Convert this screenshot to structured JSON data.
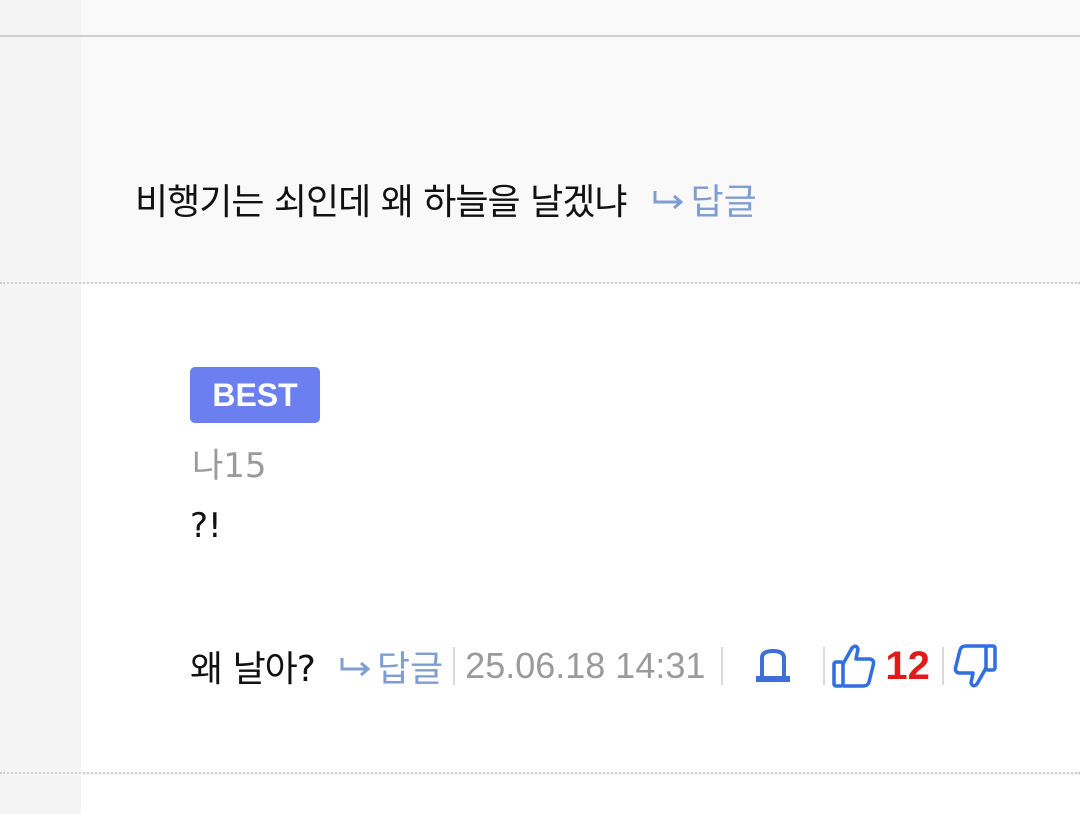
{
  "parent_comment": {
    "text": "비행기는 쇠인데 왜 하늘을 날겠냐",
    "reply_label": "답글"
  },
  "best_comment": {
    "badge": "BEST",
    "author": "나15",
    "body": "?!",
    "quote": "왜 날아?",
    "reply_label": "답글",
    "timestamp": "25.06.18 14:31",
    "like_count": "12"
  },
  "colors": {
    "badge_bg": "#6b7ff0",
    "link": "#7e9ed1",
    "like_count": "#e01b1b",
    "icon_blue": "#2f6fe0"
  },
  "icons": [
    "reply-arrow-icon",
    "siren-icon",
    "thumbs-up-icon",
    "thumbs-down-icon"
  ]
}
